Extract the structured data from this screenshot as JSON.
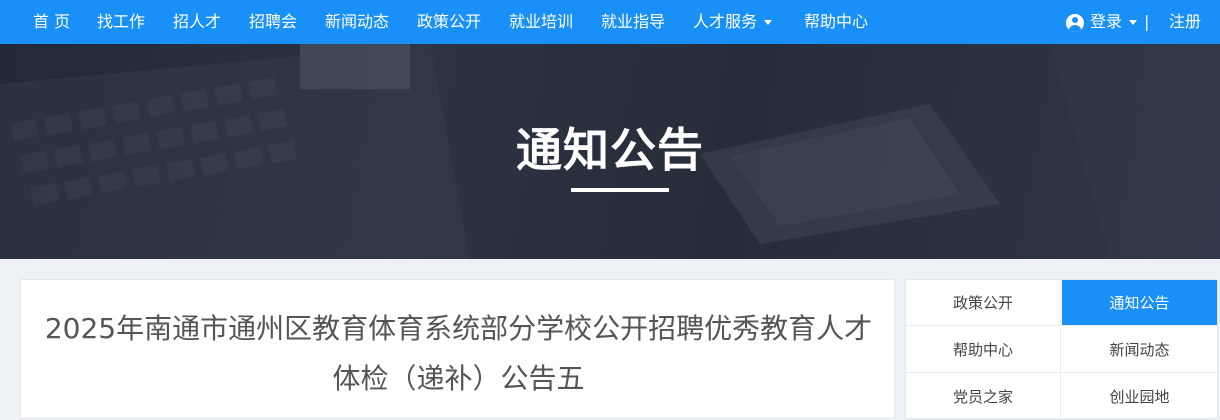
{
  "nav": {
    "items": [
      {
        "label": "首 页"
      },
      {
        "label": "找工作"
      },
      {
        "label": "招人才"
      },
      {
        "label": "招聘会"
      },
      {
        "label": "新闻动态"
      },
      {
        "label": "政策公开"
      },
      {
        "label": "就业培训"
      },
      {
        "label": "就业指导"
      },
      {
        "label": "人才服务",
        "has_dropdown": true
      },
      {
        "label": "帮助中心"
      }
    ],
    "login_label": "登录",
    "separator": "|",
    "register_label": "注册",
    "icons": [
      "user-icon",
      "chevron-down-icon"
    ]
  },
  "banner": {
    "title": "通知公告"
  },
  "article": {
    "title": "2025年南通市通州区教育体育系统部分学校公开招聘优秀教育人才体检（递补）公告五"
  },
  "sidebar": {
    "items": [
      {
        "label": "政策公开",
        "active": false
      },
      {
        "label": "通知公告",
        "active": true
      },
      {
        "label": "帮助中心",
        "active": false
      },
      {
        "label": "新闻动态",
        "active": false
      },
      {
        "label": "党员之家",
        "active": false
      },
      {
        "label": "创业园地",
        "active": false
      }
    ]
  },
  "colors": {
    "primary": "#1890f7",
    "banner_bg": "#2a3040",
    "page_bg": "#eef2f7"
  }
}
